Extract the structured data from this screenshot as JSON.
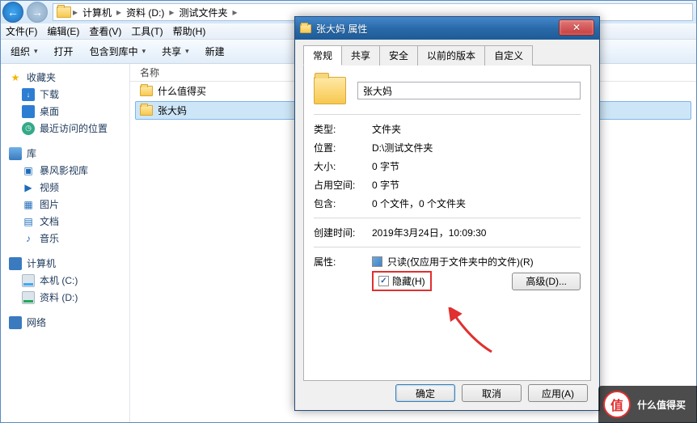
{
  "breadcrumb": {
    "items": [
      "计算机",
      "资料 (D:)",
      "测试文件夹"
    ]
  },
  "menubar": {
    "file": "文件(F)",
    "edit": "编辑(E)",
    "view": "查看(V)",
    "tools": "工具(T)",
    "help": "帮助(H)"
  },
  "toolbar": {
    "organize": "组织",
    "open": "打开",
    "include": "包含到库中",
    "share": "共享",
    "newfolder": "新建"
  },
  "sidebar": {
    "fav": {
      "label": "收藏夹",
      "items": [
        {
          "label": "下载"
        },
        {
          "label": "桌面"
        },
        {
          "label": "最近访问的位置"
        }
      ]
    },
    "lib": {
      "label": "库",
      "items": [
        {
          "label": "暴风影视库"
        },
        {
          "label": "视频"
        },
        {
          "label": "图片"
        },
        {
          "label": "文档"
        },
        {
          "label": "音乐"
        }
      ]
    },
    "pc": {
      "label": "计算机",
      "items": [
        {
          "label": "本机 (C:)"
        },
        {
          "label": "资料 (D:)"
        }
      ]
    },
    "net": {
      "label": "网络"
    }
  },
  "filepane": {
    "col_name": "名称",
    "rows": [
      {
        "name": "什么值得买"
      },
      {
        "name": "张大妈"
      }
    ]
  },
  "dialog": {
    "title": "张大妈 属性",
    "tabs": {
      "general": "常规",
      "share": "共享",
      "security": "安全",
      "prev": "以前的版本",
      "custom": "自定义"
    },
    "name": "张大妈",
    "rows": {
      "type": {
        "label": "类型:",
        "value": "文件夹"
      },
      "location": {
        "label": "位置:",
        "value": "D:\\测试文件夹"
      },
      "size": {
        "label": "大小:",
        "value": "0 字节"
      },
      "ondisk": {
        "label": "占用空间:",
        "value": "0 字节"
      },
      "contains": {
        "label": "包含:",
        "value": "0 个文件，0 个文件夹"
      },
      "created": {
        "label": "创建时间:",
        "value": "2019年3月24日，10:09:30"
      },
      "attrs_label": "属性:",
      "readonly": "只读(仅应用于文件夹中的文件)(R)",
      "hidden": "隐藏(H)",
      "advanced": "高级(D)..."
    },
    "buttons": {
      "ok": "确定",
      "cancel": "取消",
      "apply": "应用(A)"
    }
  },
  "watermark": {
    "badge": "值",
    "text": "什么值得买"
  }
}
